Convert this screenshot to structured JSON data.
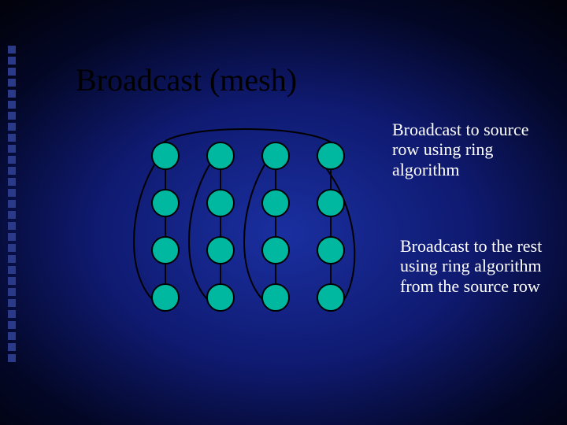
{
  "title": "Broadcast (mesh)",
  "captions": {
    "top": "Broadcast to source row using ring algorithm",
    "bottom": "Broadcast to the rest using ring algorithm from the source row"
  },
  "diagram": {
    "rows": 4,
    "cols": 4,
    "node_fill": "#00b89f",
    "node_stroke": "#000000",
    "edge_color": "#000000"
  }
}
